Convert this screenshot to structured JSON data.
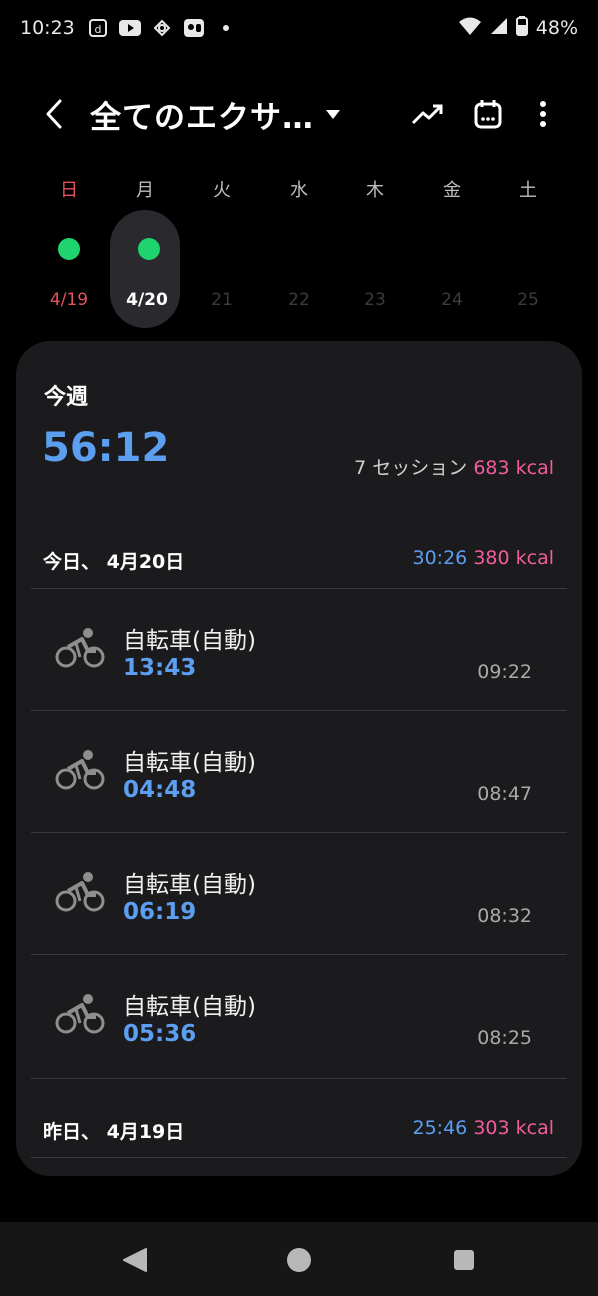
{
  "status": {
    "time": "10:23",
    "battery": "48%",
    "icons": [
      "d-icon",
      "youtube-icon",
      "sync-icon",
      "gallery-icon",
      "dot-icon"
    ]
  },
  "header": {
    "title": "全てのエクサ…",
    "icons": [
      "back-icon",
      "trend-icon",
      "calendar-icon",
      "more-icon"
    ]
  },
  "week": {
    "days": [
      {
        "name": "日",
        "date": "4/19",
        "has_activity": true,
        "selected": false
      },
      {
        "name": "月",
        "date": "4/20",
        "has_activity": true,
        "selected": true
      },
      {
        "name": "火",
        "date": "21",
        "has_activity": false,
        "selected": false
      },
      {
        "name": "水",
        "date": "22",
        "has_activity": false,
        "selected": false
      },
      {
        "name": "木",
        "date": "23",
        "has_activity": false,
        "selected": false
      },
      {
        "name": "金",
        "date": "24",
        "has_activity": false,
        "selected": false
      },
      {
        "name": "土",
        "date": "25",
        "has_activity": false,
        "selected": false
      }
    ]
  },
  "summary": {
    "label": "今週",
    "total_time": "56:12",
    "sessions": "7 セッション",
    "kcal": "683 kcal"
  },
  "today": {
    "label": "今日、 4月20日",
    "time": "30:26",
    "kcal": "380 kcal",
    "sessions": [
      {
        "name": "自転車(自動)",
        "duration": "13:43",
        "start": "09:22",
        "icon": "cycling-icon"
      },
      {
        "name": "自転車(自動)",
        "duration": "04:48",
        "start": "08:47",
        "icon": "cycling-icon"
      },
      {
        "name": "自転車(自動)",
        "duration": "06:19",
        "start": "08:32",
        "icon": "cycling-icon"
      },
      {
        "name": "自転車(自動)",
        "duration": "05:36",
        "start": "08:25",
        "icon": "cycling-icon"
      }
    ]
  },
  "yesterday": {
    "label": "昨日、 4月19日",
    "time": "25:46",
    "kcal": "303 kcal"
  },
  "colors": {
    "accent_blue": "#5c9ef0",
    "kcal_pink": "#f25c9c",
    "activity_green": "#1fd36f",
    "sunday_red": "#e0545a"
  },
  "nav": {
    "icons": [
      "nav-back-icon",
      "nav-home-icon",
      "nav-recents-icon"
    ]
  }
}
